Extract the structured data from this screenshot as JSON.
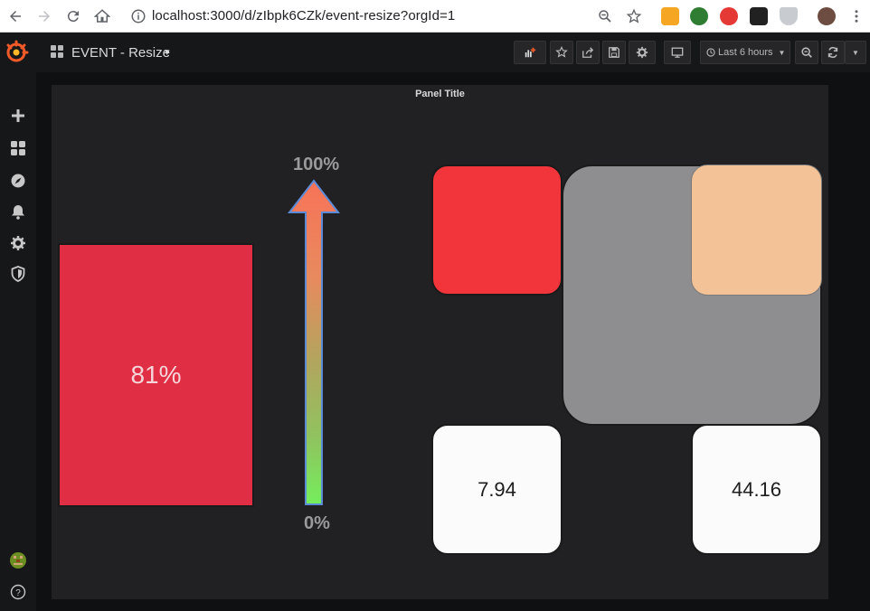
{
  "browser": {
    "url": "localhost:3000/d/zIbpk6CZk/event-resize?orgId=1"
  },
  "dashboard": {
    "title": "EVENT - Resize",
    "caret": "▾",
    "time_range": "Last 6 hours"
  },
  "panel": {
    "title": "Panel Title",
    "gauge_value": "81%",
    "gauge_fraction": 0.81,
    "arrow_top_label": "100%",
    "arrow_bottom_label": "0%",
    "tile_a_value": "7.94",
    "tile_b_value": "44.16"
  },
  "colors": {
    "gauge": "#e02f44",
    "tile_red": "#f2353a",
    "tile_orange": "#f08628",
    "tile_grey": "#8e8e90",
    "tile_peach": "#f3c297",
    "tile_white": "#fbfbfb",
    "grafana_orange": "#f05a28"
  },
  "icons": {
    "browser": [
      "back-icon",
      "forward-icon",
      "reload-icon",
      "home-icon",
      "info-icon",
      "zoom-icon",
      "star-icon",
      "menu-dots-icon"
    ],
    "toolbar": [
      "add-panel-icon",
      "star-icon",
      "share-icon",
      "save-icon",
      "settings-icon",
      "tv-mode-icon",
      "clock-icon",
      "zoom-out-icon",
      "refresh-icon",
      "chevron-down-icon"
    ],
    "sidemenu": [
      "plus-icon",
      "dashboards-icon",
      "explore-icon",
      "bell-icon",
      "gear-icon",
      "shield-icon",
      "user-avatar",
      "help-icon"
    ]
  }
}
